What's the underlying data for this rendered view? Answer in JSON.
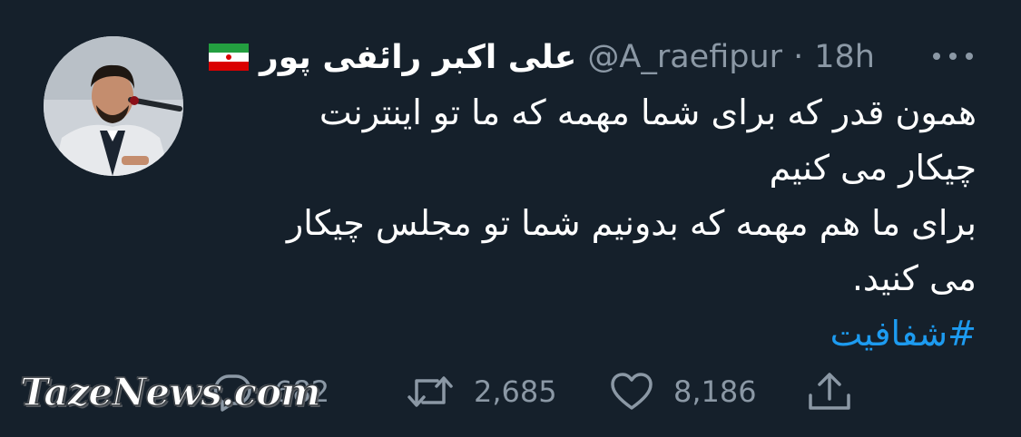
{
  "author": {
    "display_name": "علی اکبر رائفی پور",
    "handle": "@A_raefipur",
    "separator": "·",
    "time": "18h",
    "flag": "iran-flag-emoji",
    "avatar": "speaker-photo"
  },
  "tweet": {
    "lines": [
      "همون قدر که برای شما مهمه که ما تو اینترنت",
      "چیکار می کنیم",
      "برای ما هم مهمه که بدونیم شما تو مجلس چیکار",
      "می کنید."
    ],
    "hashtag": "#شفافیت"
  },
  "actions": {
    "reply_count": "682",
    "retweet_count": "2,685",
    "like_count": "8,186",
    "icons": [
      "reply-icon",
      "retweet-icon",
      "like-icon",
      "share-icon"
    ]
  },
  "watermark": {
    "text": "TazeNews.com"
  },
  "colors": {
    "background": "#15202b",
    "text": "#ffffff",
    "secondary": "#8b98a5",
    "link": "#1d9bf0"
  }
}
